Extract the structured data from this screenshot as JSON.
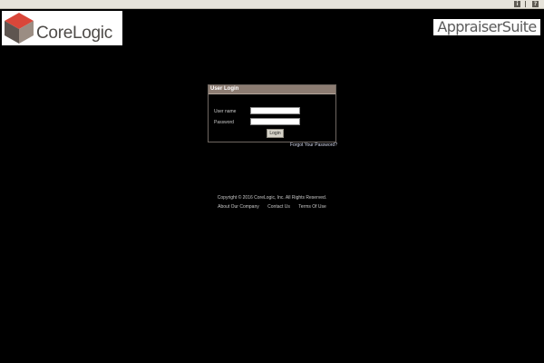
{
  "topbar": {
    "icons": [
      {
        "name": "info-icon",
        "glyph": "i"
      },
      {
        "name": "help-icon",
        "glyph": "?"
      }
    ]
  },
  "logo": {
    "text": "CoreLogic",
    "colors": {
      "top": "#d9473a",
      "left": "#5e5550",
      "right": "#9b8d83"
    }
  },
  "brand": {
    "name": "AppraiserSuite"
  },
  "login": {
    "title": "User Login",
    "username_label": "User name",
    "username_value": "",
    "password_label": "Password",
    "password_value": "",
    "button_label": "Login"
  },
  "forgot_link": "Forgot Your Password?",
  "footer": {
    "copyright": "Copyright © 2016 CoreLogic, Inc. All Rights Reserved.",
    "links": [
      "About Our Company",
      "Contact Us",
      "Terms Of Use"
    ]
  }
}
